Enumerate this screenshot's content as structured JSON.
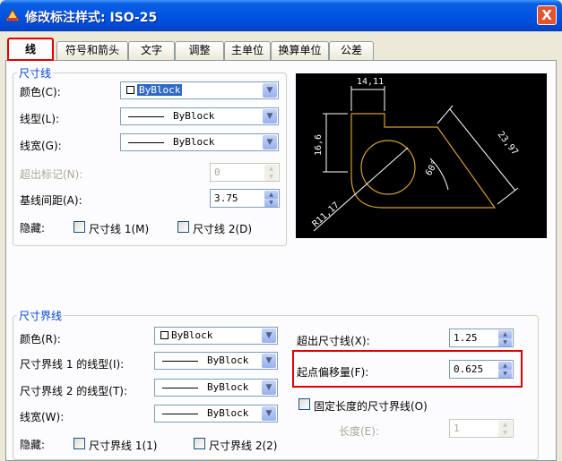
{
  "window": {
    "title": "修改标注样式: ISO-25",
    "close": "X"
  },
  "tabs": [
    "线",
    "符号和箭头",
    "文字",
    "调整",
    "主单位",
    "换算单位",
    "公差"
  ],
  "dim_lines": {
    "legend": "尺寸线",
    "color_label": "颜色(C):",
    "color_value": "ByBlock",
    "linetype_label": "线型(L):",
    "linetype_value": "ByBlock",
    "lineweight_label": "线宽(G):",
    "lineweight_value": "ByBlock",
    "extend_ticks_label": "超出标记(N):",
    "extend_ticks_value": "0",
    "baseline_spacing_label": "基线间距(A):",
    "baseline_spacing_value": "3.75",
    "suppress_label": "隐藏:",
    "suppress_1": "尺寸线 1(M)",
    "suppress_2": "尺寸线 2(D)"
  },
  "ext_lines": {
    "legend": "尺寸界线",
    "color_label": "颜色(R):",
    "color_value": "ByBlock",
    "linetype1_label": "尺寸界线 1 的线型(I):",
    "linetype1_value": "ByBlock",
    "linetype2_label": "尺寸界线 2 的线型(T):",
    "linetype2_value": "ByBlock",
    "lineweight_label": "线宽(W):",
    "lineweight_value": "ByBlock",
    "suppress_label": "隐藏:",
    "suppress_1": "尺寸界线 1(1)",
    "suppress_2": "尺寸界线 2(2)",
    "extend_label": "超出尺寸线(X):",
    "extend_value": "1.25",
    "offset_label": "起点偏移量(F):",
    "offset_value": "0.625",
    "fixed_length_label": "固定长度的尺寸界线(O)",
    "length_label": "长度(E):",
    "length_value": "1"
  },
  "preview_dims": {
    "top": "14,11",
    "left": "16,6",
    "right": "23,97",
    "angle": "60°",
    "radius": "R11,17"
  }
}
